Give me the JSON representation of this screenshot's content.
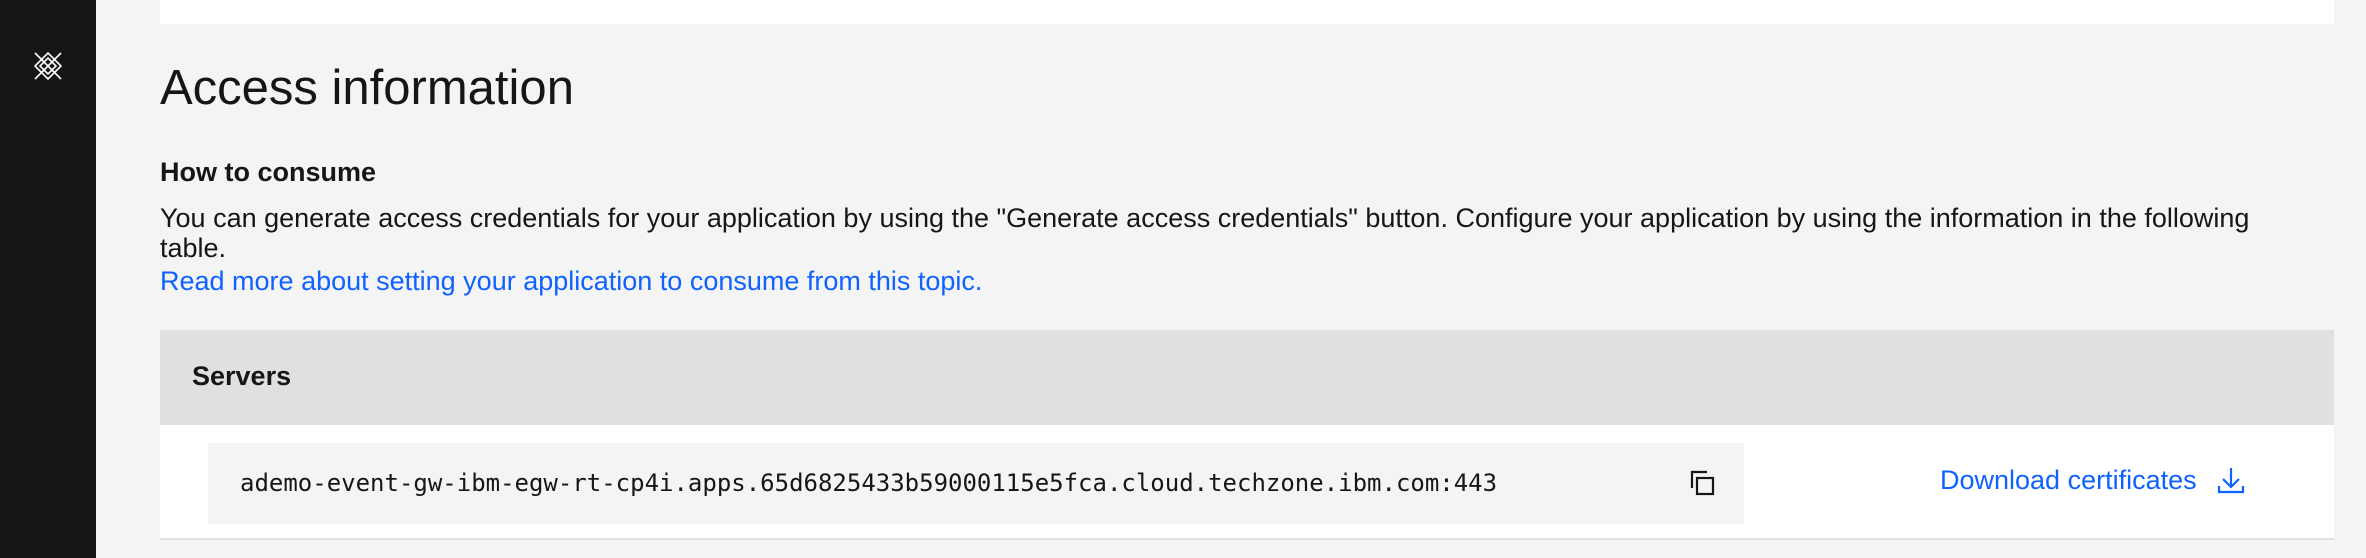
{
  "sidebar": {
    "icon": "event-gateway-icon"
  },
  "access": {
    "title": "Access information",
    "subheading": "How to consume",
    "description": "You can generate access credentials for your application by using the \"Generate access credentials\" button. Configure your application by using the information in the following table.",
    "read_more_link": "Read more about setting your application to consume from this topic."
  },
  "servers": {
    "header": "Servers",
    "address": "ademo-event-gw-ibm-egw-rt-cp4i.apps.65d6825433b59000115e5fca.cloud.techzone.ibm.com:443",
    "copy_icon": "copy-icon",
    "download_label": "Download certificates",
    "download_icon": "download-icon"
  },
  "colors": {
    "link": "#0f62fe",
    "sidebar": "#161616",
    "background": "#f4f4f4",
    "table_header": "#e0e0e0"
  }
}
